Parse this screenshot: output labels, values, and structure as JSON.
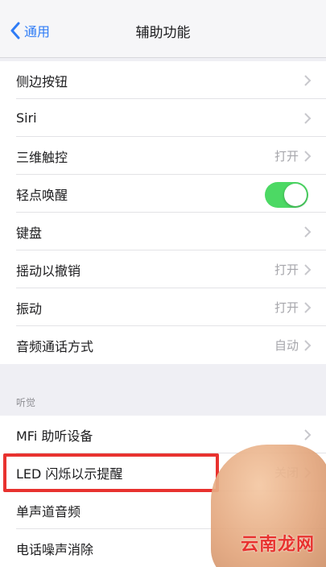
{
  "nav": {
    "back_label": "通用",
    "title": "辅助功能"
  },
  "group1": {
    "items": [
      {
        "label": "侧边按钮",
        "value": ""
      },
      {
        "label": "Siri",
        "value": ""
      },
      {
        "label": "三维触控",
        "value": "打开"
      },
      {
        "label": "轻点唤醒",
        "value": "",
        "toggle": true
      },
      {
        "label": "键盘",
        "value": ""
      },
      {
        "label": "摇动以撤销",
        "value": "打开"
      },
      {
        "label": "振动",
        "value": "打开"
      },
      {
        "label": "音频通话方式",
        "value": "自动"
      }
    ]
  },
  "section_header": "听觉",
  "group2": {
    "items": [
      {
        "label": "MFi 助听设备",
        "value": ""
      },
      {
        "label": "LED 闪烁以示提醒",
        "value": "关闭"
      },
      {
        "label": "单声道音频",
        "value": ""
      },
      {
        "label": "电话噪声消除",
        "value": ""
      }
    ]
  },
  "watermark": "云南龙网",
  "colors": {
    "accent": "#2f7cf6",
    "toggle_on": "#4cd964",
    "highlight": "#e8322f"
  },
  "icons": {
    "back": "chevron-left-icon",
    "disclosure": "chevron-right-icon"
  }
}
